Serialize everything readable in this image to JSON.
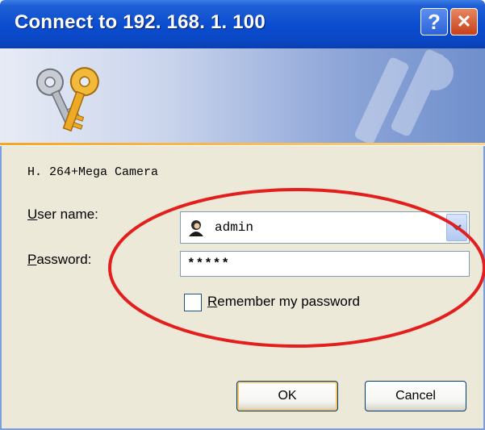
{
  "window": {
    "title": "Connect to 192. 168. 1. 100",
    "help_glyph": "?",
    "close_glyph": "✕"
  },
  "dialog": {
    "realm_text": "H. 264+Mega Camera",
    "username_label": "User name:",
    "username_value": "admin",
    "password_label": "Password:",
    "password_value": "*****",
    "remember_label": "Remember my password",
    "remember_checked": false
  },
  "buttons": {
    "ok_label": "OK",
    "cancel_label": "Cancel"
  },
  "colors": {
    "titlebar": "#0a4ccf",
    "annotation": "#e41d1d",
    "dialog_bg": "#ece9d8"
  },
  "icons": {
    "banner": "keys-icon",
    "user": "user-avatar-icon",
    "dropdown": "chevron-down-icon"
  }
}
